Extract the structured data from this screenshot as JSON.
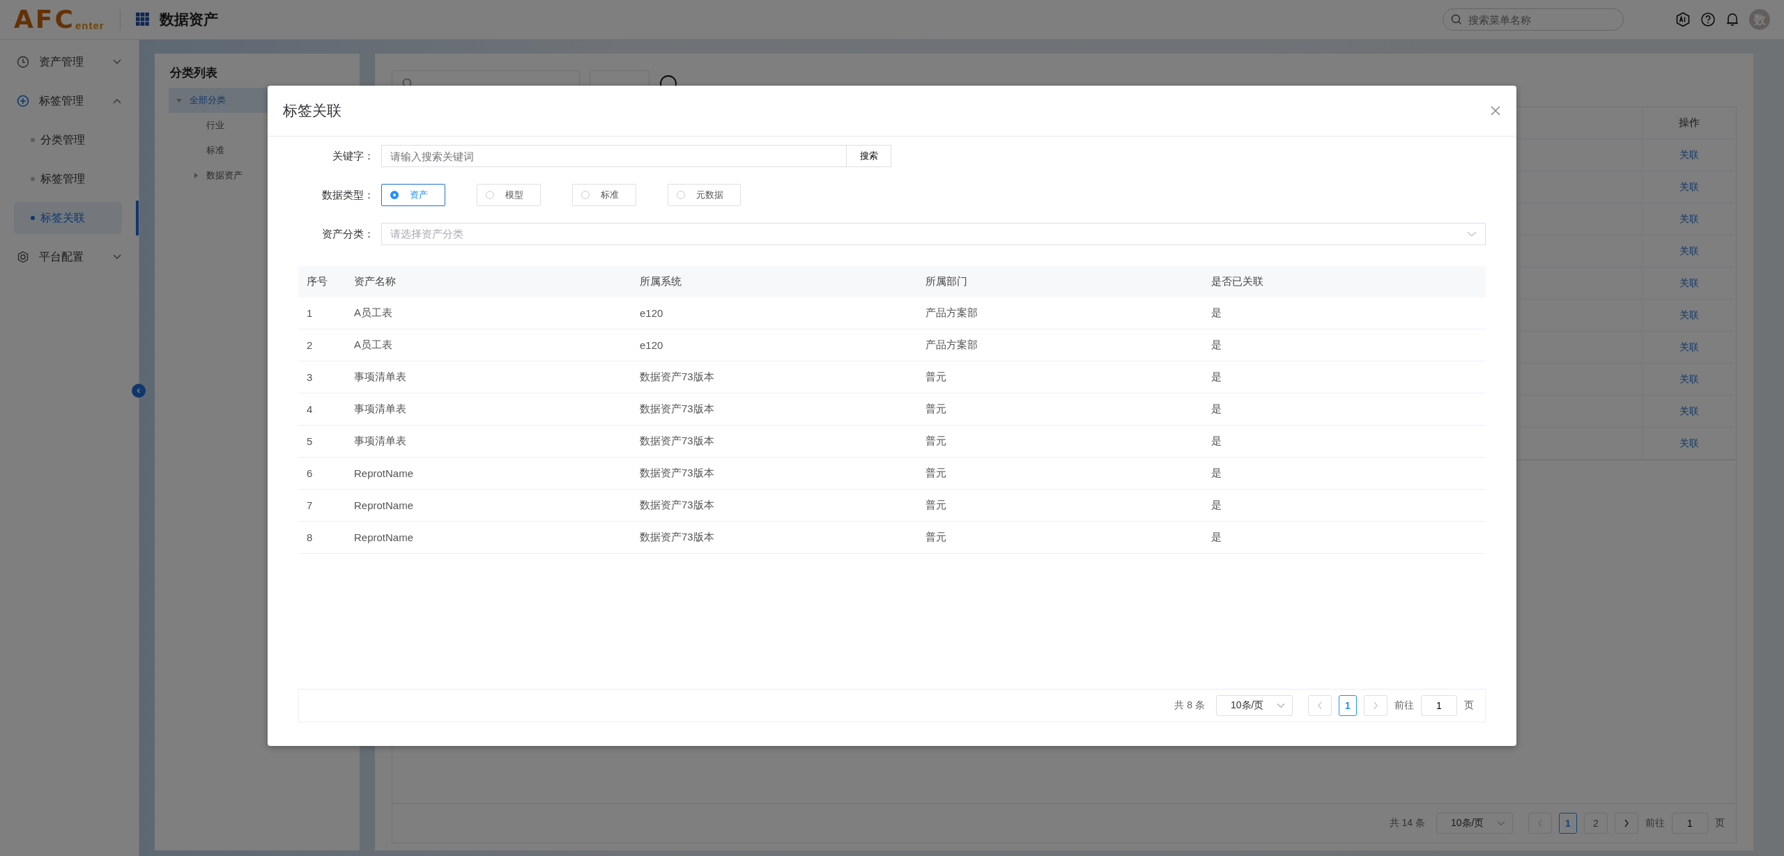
{
  "header": {
    "logo": {
      "main": "AFC",
      "sub": "enter"
    },
    "app_title": "数据资产",
    "search": {
      "placeholder": "搜索菜单名称"
    },
    "avatar": "数"
  },
  "sidebar": {
    "items": [
      {
        "label": "资产管理",
        "kind": "clock",
        "expanded": false
      },
      {
        "label": "标签管理",
        "kind": "plus",
        "expanded": true,
        "children": [
          {
            "label": "分类管理",
            "selected": false
          },
          {
            "label": "标签管理",
            "selected": false
          },
          {
            "label": "标签关联",
            "selected": true
          }
        ]
      },
      {
        "label": "平台配置",
        "kind": "gear",
        "expanded": false
      }
    ]
  },
  "category_panel": {
    "title": "分类列表",
    "tree": [
      {
        "label": "全部分类",
        "expanded": true,
        "selected": true,
        "children": [
          {
            "label": "行业",
            "selected": false
          },
          {
            "label": "标准",
            "selected": false
          },
          {
            "label": "数据资产",
            "expanded": false,
            "selected": false
          }
        ]
      }
    ]
  },
  "content": {
    "table": {
      "action_column": "操作",
      "rows": [
        {
          "action": "关联"
        },
        {
          "action": "关联"
        },
        {
          "action": "关联"
        },
        {
          "action": "关联"
        },
        {
          "action": "关联"
        },
        {
          "action": "关联"
        },
        {
          "action": "关联"
        },
        {
          "action": "关联"
        },
        {
          "action": "关联"
        },
        {
          "action": "关联"
        }
      ]
    },
    "pagination": {
      "total": "共 14 条",
      "page_size": "10条/页",
      "pages": [
        {
          "label": "1",
          "selected": true
        },
        {
          "label": "2",
          "selected": false
        }
      ],
      "goto_label": "前往",
      "goto_value": "1",
      "page_unit": "页"
    }
  },
  "dialog": {
    "title": "标签关联",
    "keyword": {
      "label": "关键字：",
      "placeholder": "请输入搜索关键词",
      "button": "搜索"
    },
    "data_type": {
      "label": "数据类型：",
      "options": [
        {
          "label": "资产",
          "selected": true
        },
        {
          "label": "模型",
          "selected": false
        },
        {
          "label": "标准",
          "selected": false
        },
        {
          "label": "元数据",
          "selected": false
        }
      ]
    },
    "category": {
      "label": "资产分类：",
      "placeholder": "请选择资产分类"
    },
    "table": {
      "columns": [
        "序号",
        "资产名称",
        "所属系统",
        "所属部门",
        "是否已关联"
      ],
      "rows": [
        [
          "1",
          "A员工表",
          "e120",
          "产品方案部",
          "是"
        ],
        [
          "2",
          "A员工表",
          "e120",
          "产品方案部",
          "是"
        ],
        [
          "3",
          "事项清单表",
          "数据资产73版本",
          "普元",
          "是"
        ],
        [
          "4",
          "事项清单表",
          "数据资产73版本",
          "普元",
          "是"
        ],
        [
          "5",
          "事项清单表",
          "数据资产73版本",
          "普元",
          "是"
        ],
        [
          "6",
          "ReprotName",
          "数据资产73版本",
          "普元",
          "是"
        ],
        [
          "7",
          "ReprotName",
          "数据资产73版本",
          "普元",
          "是"
        ],
        [
          "8",
          "ReprotName",
          "数据资产73版本",
          "普元",
          "是"
        ]
      ]
    },
    "pagination": {
      "total": "共 8 条",
      "page_size": "10条/页",
      "pages": [
        {
          "label": "1",
          "selected": true
        }
      ],
      "goto_label": "前往",
      "goto_value": "1",
      "page_unit": "页"
    }
  }
}
